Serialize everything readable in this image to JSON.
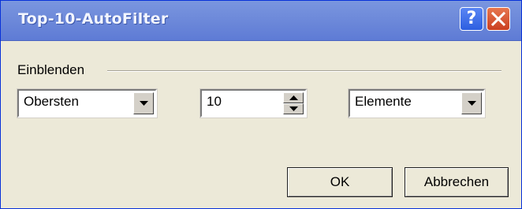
{
  "window": {
    "title": "Top-10-AutoFilter",
    "help_glyph": "?",
    "help_icon": "help-icon",
    "close_icon": "close-icon"
  },
  "group": {
    "label": "Einblenden"
  },
  "controls": {
    "direction": {
      "value": "Obersten"
    },
    "count": {
      "value": "10"
    },
    "unit": {
      "value": "Elemente"
    }
  },
  "buttons": {
    "ok_label": "OK",
    "cancel_label": "Abbrechen"
  },
  "colors": {
    "titlebar": "#6E8ADA",
    "dialog_bg": "#ECE9D8",
    "close_button": "#cb3f21",
    "help_button": "#2d5fe0"
  }
}
